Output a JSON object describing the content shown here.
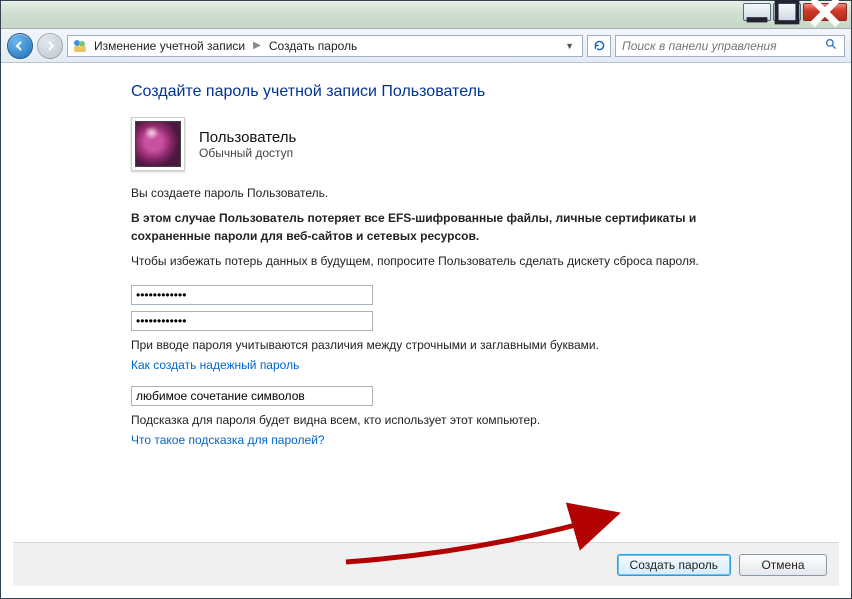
{
  "breadcrumb": {
    "item1": "Изменение учетной записи",
    "item2": "Создать пароль"
  },
  "search": {
    "placeholder": "Поиск в панели управления"
  },
  "page": {
    "title": "Создайте пароль учетной записи Пользователь",
    "user_name": "Пользователь",
    "user_type": "Обычный доступ",
    "line1": "Вы создаете пароль Пользователь.",
    "line2": "В этом случае Пользователь потеряет все EFS-шифрованные файлы, личные сертификаты и сохраненные пароли для веб-сайтов и сетевых ресурсов.",
    "line3": "Чтобы избежать потерь данных в будущем, попросите Пользователь сделать дискету сброса пароля.",
    "pwd1": "••••••••••••",
    "pwd2": "••••••••••••",
    "caps_note": "При вводе пароля учитываются различия между строчными и заглавными буквами.",
    "link1": "Как создать надежный пароль",
    "hint_value": "любимое сочетание символов",
    "hint_note": "Подсказка для пароля будет видна всем, кто использует этот компьютер.",
    "link2": "Что такое подсказка для паролей?"
  },
  "buttons": {
    "create": "Создать пароль",
    "cancel": "Отмена"
  }
}
